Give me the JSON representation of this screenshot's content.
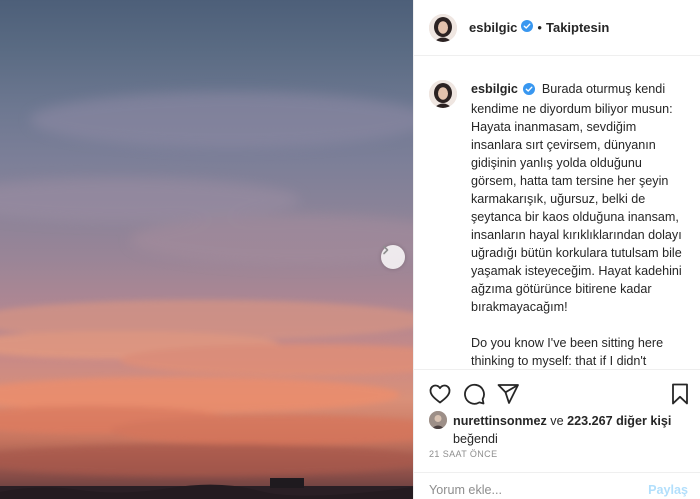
{
  "post": {
    "username": "esbilgic",
    "follow_status": "Takiptesin",
    "caption_paragraphs": [
      "Burada oturmuş kendi kendime ne diyordum biliyor musun: Hayata inanmasam, sevdiğim insanlara sırt çevirsem, dünyanın gidişinin yanlış yolda olduğunu görsem, hatta tam tersine her şeyin karmakarışık, uğursuz, belki de şeytanca bir kaos olduğuna inansam, insanların hayal kırıklıklarından dolayı uğradığı bütün korkulara tutulsam bile yaşamak isteyeceğim. Hayat kadehini ağzıma götürünce bitirene kadar bırakmayacağım!",
      "Do you know I've been sitting here thinking to myself: that if I didn't believe in life, if I lost faith in the people I love, lost faith in the order of things, were convinced in fact that"
    ],
    "likes": {
      "liker": "nurettinsonmez",
      "connector": "ve",
      "others_count": "223.267 diğer kişi",
      "liked_text": "beğendi"
    },
    "time_ago": "21 SAAT ÖNCE"
  },
  "comment": {
    "placeholder": "Yorum ekle...",
    "post_label": "Paylaş"
  },
  "icons": {
    "verified": "verified-badge-icon",
    "like": "heart-icon",
    "comment": "comment-bubble-icon",
    "share": "paper-plane-icon",
    "save": "bookmark-icon",
    "next": "chevron-right-icon"
  },
  "colors": {
    "verified_blue": "#3897f0",
    "text": "#262626",
    "muted": "#8e8e8e",
    "post_button_disabled": "#b2dffc"
  }
}
